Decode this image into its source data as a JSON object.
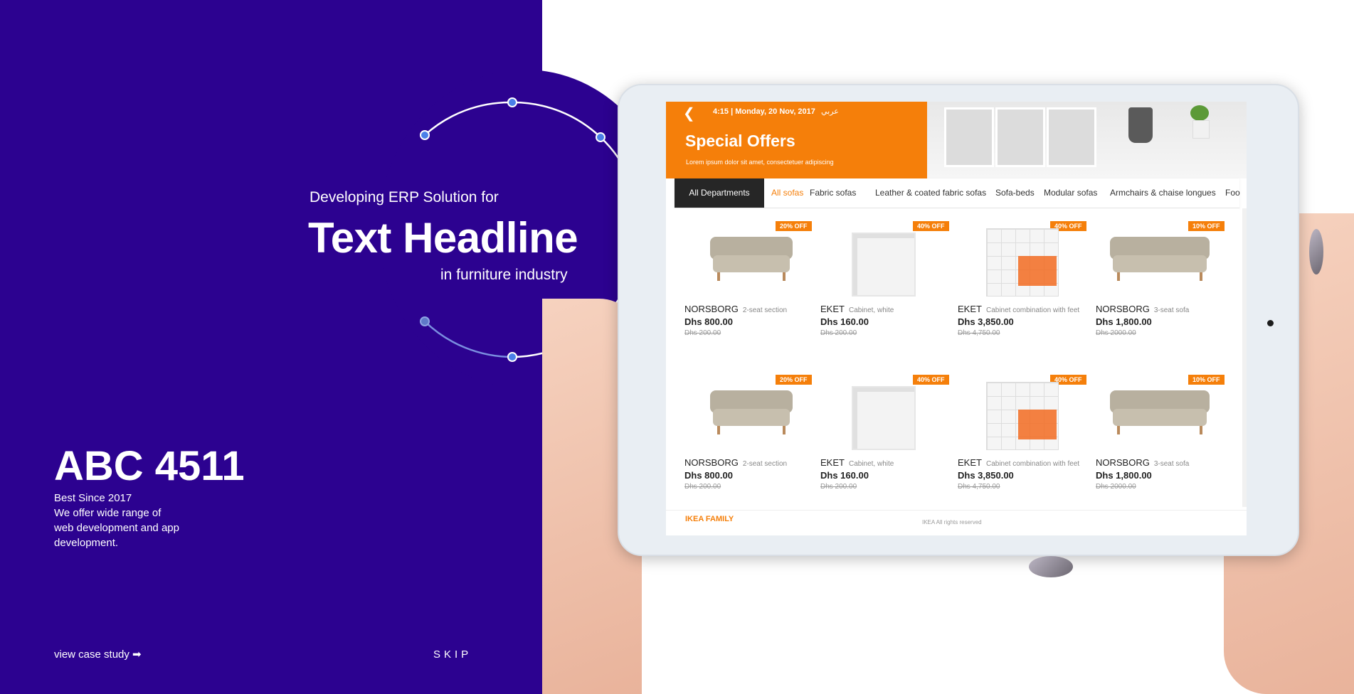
{
  "hero": {
    "eyebrow": "Developing ERP Solution for",
    "headline": "Text Headline",
    "subline": "in furniture industry"
  },
  "brand": {
    "name": "ABC 4511",
    "desc_lines": [
      "Best Since 2017",
      "We offer wide range of",
      "web development and app",
      "development."
    ]
  },
  "footer_nav": {
    "case_study": "view case study ➡",
    "skip": "SKIP"
  },
  "colors": {
    "panel": "#2c0290",
    "accent_orange": "#f57f0a",
    "node_blue": "#4a7fe8"
  },
  "tablet_app": {
    "back_icon": "chevron-left-icon",
    "status_time": "4:15 | Monday, 20 Nov, 2017",
    "status_arabic": "عربي",
    "title": "Special Offers",
    "subtitle": "Lorem ipsum dolor sit amet, consectetuer adipiscing",
    "tabs": [
      "All Departments",
      "All sofas",
      "Fabric sofas",
      "Leather & coated fabric sofas",
      "Sofa-beds",
      "Modular sofas",
      "Armchairs & chaise longues",
      "Foo"
    ],
    "active_tab": "All sofas",
    "products": [
      {
        "name": "NORSBORG",
        "desc": "2-seat section",
        "price": "Dhs 800.00",
        "old_price": "Dhs 200.00",
        "badge": "20% OFF",
        "type": "sofa"
      },
      {
        "name": "EKET",
        "desc": "Cabinet, white",
        "price": "Dhs 160.00",
        "old_price": "Dhs 200.00",
        "badge": "40% OFF",
        "type": "cube"
      },
      {
        "name": "EKET",
        "desc": "Cabinet combination with feet",
        "price": "Dhs 3,850.00",
        "old_price": "Dhs 4,750.00",
        "badge": "40% OFF",
        "type": "shelf"
      },
      {
        "name": "NORSBORG",
        "desc": "3-seat sofa",
        "price": "Dhs 1,800.00",
        "old_price": "Dhs 2000.00",
        "badge": "10% OFF",
        "type": "sofa"
      },
      {
        "name": "NORSBORG",
        "desc": "2-seat section",
        "price": "Dhs 800.00",
        "old_price": "Dhs 200.00",
        "badge": "20% OFF",
        "type": "sofa"
      },
      {
        "name": "EKET",
        "desc": "Cabinet, white",
        "price": "Dhs 160.00",
        "old_price": "Dhs 200.00",
        "badge": "40% OFF",
        "type": "cube"
      },
      {
        "name": "EKET",
        "desc": "Cabinet combination with feet",
        "price": "Dhs 3,850.00",
        "old_price": "Dhs 4,750.00",
        "badge": "40% OFF",
        "type": "shelf"
      },
      {
        "name": "NORSBORG",
        "desc": "3-seat sofa",
        "price": "Dhs 1,800.00",
        "old_price": "Dhs 2000.00",
        "badge": "10% OFF",
        "type": "sofa"
      }
    ],
    "footer_logo": "IKEA FAMILY",
    "footer_copy": "IKEA All rights reserved"
  }
}
